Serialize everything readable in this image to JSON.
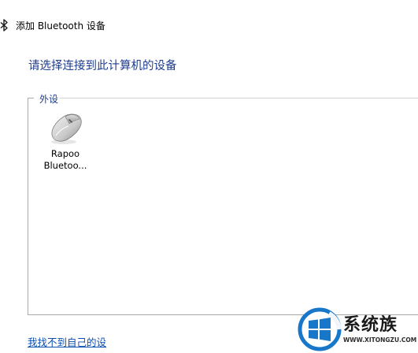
{
  "window": {
    "title": "添加 Bluetooth 设备",
    "icon": "bluetooth-icon"
  },
  "instruction": "请选择连接到此计算机的设备",
  "group": {
    "label": "外设"
  },
  "devices": [
    {
      "name_line1": "Rapoo",
      "name_line2": "Bluetoo...",
      "icon": "mouse-icon"
    }
  ],
  "help_link": "我找不到自己的设",
  "watermark": {
    "cn": "系统族",
    "url": "WWW.XITONGZU.COM",
    "icon": "windows-logo-icon"
  },
  "colors": {
    "instruction": "#1e3d8f",
    "link": "#0b4fb0",
    "border": "#a9a9a9"
  }
}
